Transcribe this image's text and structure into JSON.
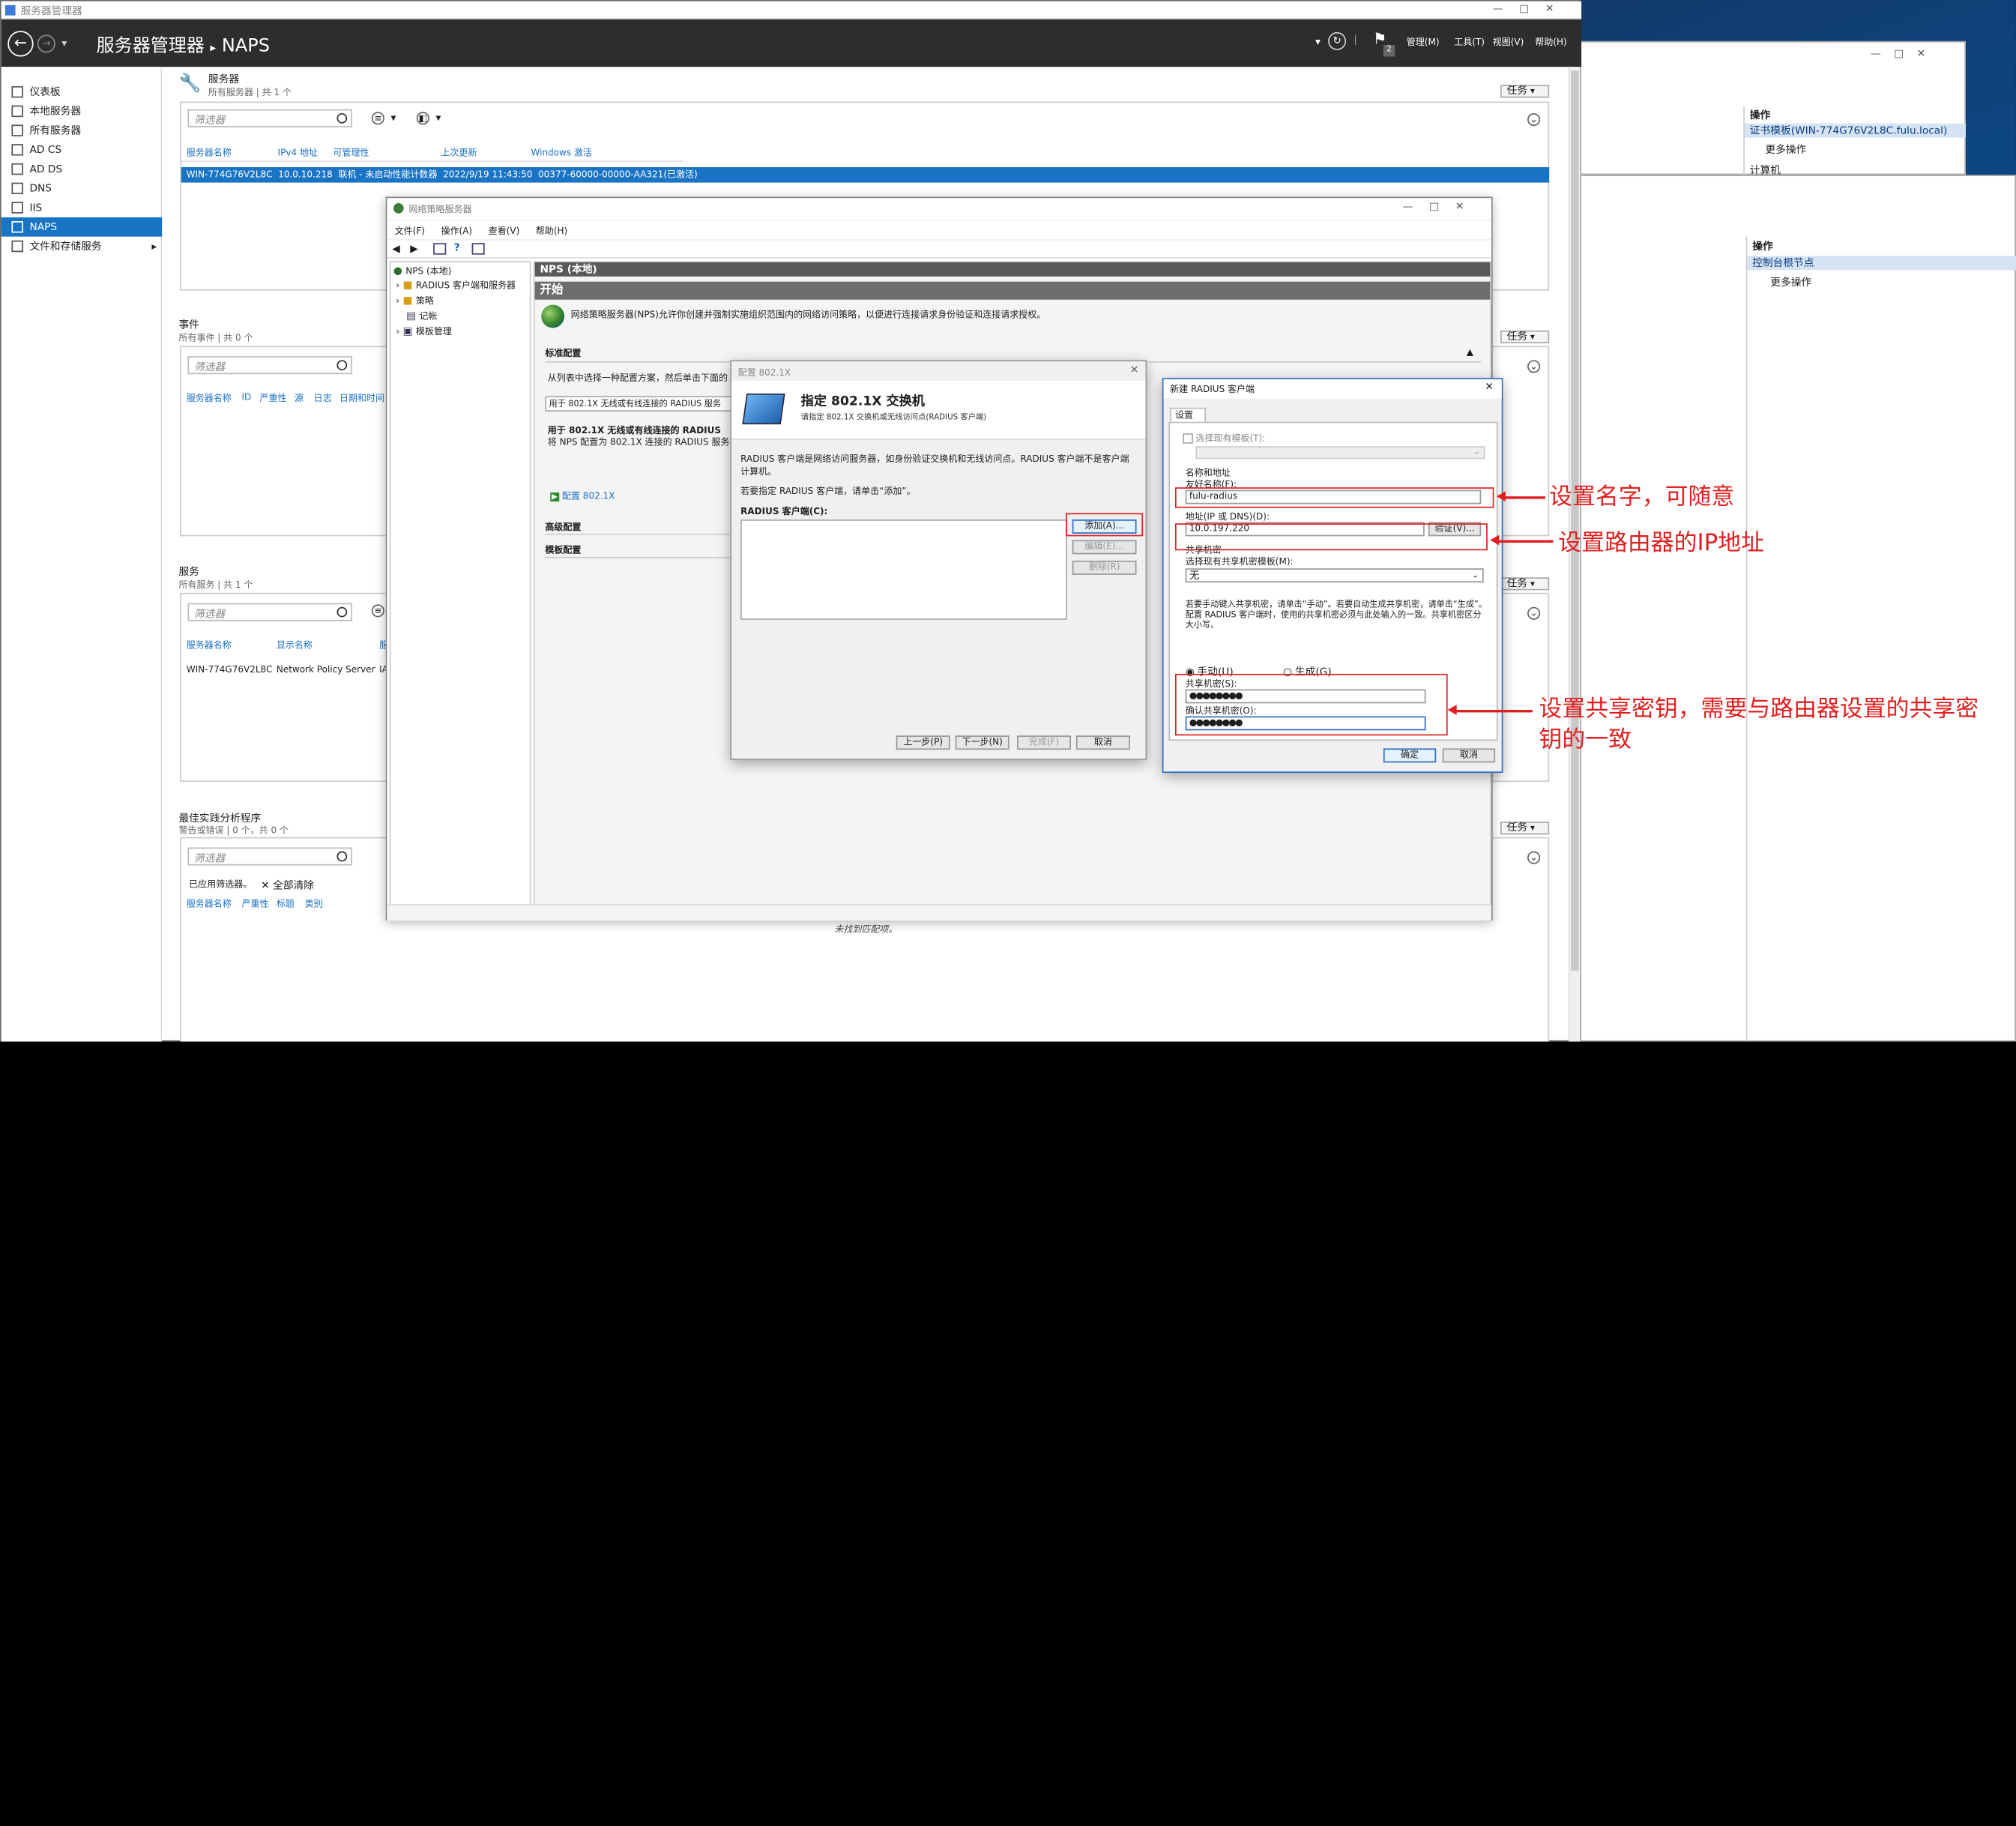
{
  "sm": {
    "title": "服务器管理器",
    "breadcrumb_root": "服务器管理器",
    "breadcrumb_sep": "▸",
    "breadcrumb_leaf": "NAPS",
    "menu": [
      "管理(M)",
      "工具(T)",
      "视图(V)",
      "帮助(H)"
    ],
    "flag_count": "2",
    "nav": [
      "仪表板",
      "本地服务器",
      "所有服务器",
      "AD CS",
      "AD DS",
      "DNS",
      "IIS",
      "NAPS",
      "文件和存储服务"
    ],
    "servers": {
      "title": "服务器",
      "subtitle": "所有服务器 | 共 1 个",
      "task": "任务",
      "filter": "筛选器",
      "columns": [
        "服务器名称",
        "IPv4 地址",
        "可管理性",
        "上次更新",
        "Windows 激活"
      ],
      "row": "WIN-774G76V2L8C  10.0.10.218  联机 - 未启动性能计数器  2022/9/19 11:43:50  00377-60000-00000-AA321(已激活)"
    },
    "events": {
      "title": "事件",
      "subtitle": "所有事件 | 共 0 个",
      "task": "任务",
      "filter": "筛选器",
      "columns": [
        "服务器名称",
        "ID",
        "严重性",
        "源",
        "日志",
        "日期和时间"
      ]
    },
    "services": {
      "title": "服务",
      "subtitle": "所有服务 | 共 1 个",
      "task": "任务",
      "filter": "筛选器",
      "columns": [
        "服务器名称",
        "显示名称",
        "服"
      ],
      "row_server": "WIN-774G76V2L8C",
      "row_name": "Network Policy Server",
      "row_trunc": "IA"
    },
    "bpa": {
      "title": "最佳实践分析程序",
      "subtitle": "警告或错误 | 0 个，共 0 个",
      "task": "任务",
      "filter": "筛选器",
      "applied": "已应用筛选器。",
      "clear": "全部清除",
      "columns": [
        "服务器名称",
        "严重性",
        "标题",
        "类别"
      ],
      "nomatch": "未找到匹配项。"
    }
  },
  "bg_right": {
    "ops_title": "操作",
    "cert_item": "证书模板(WIN-774G76V2L8C.fulu.local)",
    "more_ops": "更多操作",
    "computer": "计算机",
    "ops_title2": "操作",
    "console_node": "控制台根节点",
    "more_ops2": "更多操作"
  },
  "nps": {
    "title": "网络策略服务器",
    "menu": [
      "文件(F)",
      "操作(A)",
      "查看(V)",
      "帮助(H)"
    ],
    "tree": [
      "NPS (本地)",
      "RADIUS 客户端和服务器",
      "策略",
      "记帐",
      "模板管理"
    ],
    "header": "NPS (本地)",
    "start": "开始",
    "intro": "网络策略服务器(NPS)允许你创建并强制实施组织范围内的网络访问策略，以便进行连接请求身份验证和连接请求授权。",
    "std": "标准配置",
    "std_desc": "从列表中选择一种配置方案，然后单击下面的",
    "combo": "用于 802.1X 无线或有线连接的 RADIUS 服务",
    "use_title": "用于 802.1X 无线或有线连接的 RADIUS",
    "use_desc": "将 NPS 配置为 802.1X 连接的 RADIUS 服务器时",
    "config_link": "配置 802.1X",
    "advanced": "高级配置",
    "template": "模板配置"
  },
  "dlg8021x": {
    "title": "配置 802.1X",
    "heading": "指定 802.1X 交换机",
    "sub": "请指定 802.1X 交换机或无线访问点(RADIUS 客户端)",
    "desc": "RADIUS 客户端是网络访问服务器，如身份验证交换机和无线访问点。RADIUS 客户端不是客户端计算机。",
    "hint": "若要指定 RADIUS 客户端，请单击“添加”。",
    "list_label": "RADIUS 客户端(C):",
    "add": "添加(A)...",
    "edit": "编辑(E)...",
    "del": "删除(R)",
    "prev": "上一步(P)",
    "next": "下一步(N)",
    "finish": "完成(F)",
    "cancel": "取消"
  },
  "dlgradius": {
    "title": "新建 RADIUS 客户端",
    "tab": "设置",
    "use_template": "选择现有模板(T):",
    "name_addr": "名称和地址",
    "friendly_label": "友好名称(F):",
    "friendly_value": "fulu-radius",
    "addr_label": "地址(IP 或 DNS)(D):",
    "addr_value": "10.0.197.220",
    "verify": "验证(V)...",
    "shared": "共享机密",
    "shared_tpl": "选择现有共享机密模板(M):",
    "shared_tpl_val": "无",
    "shared_desc": "若要手动键入共享机密，请单击“手动”。若要自动生成共享机密，请单击“生成”。配置 RADIUS 客户端时，使用的共享机密必须与此处输入的一致。共享机密区分大小写。",
    "manual": "手动(U)",
    "generate": "生成(G)",
    "secret_label": "共享机密(S):",
    "secret_value": "●●●●●●●●",
    "confirm_label": "确认共享机密(O):",
    "confirm_value": "●●●●●●●●",
    "ok": "确定",
    "cancel": "取消"
  },
  "annotations": {
    "a1": "设置名字，可随意",
    "a2": "设置路由器的IP地址",
    "a3a": "设置共享密钥，需要与路由器设置的共享密",
    "a3b": "钥的一致"
  }
}
